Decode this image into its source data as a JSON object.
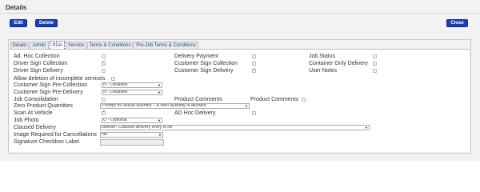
{
  "panel": {
    "title": "Details"
  },
  "toolbar": {
    "edit": "Edit",
    "delete": "Delete",
    "close": "Close"
  },
  "tabs": [
    "Details",
    "Admin",
    "PDA",
    "Service",
    "Terms & Conditions",
    "Pre-Job Terms & Conditions"
  ],
  "active_tab": "PDA",
  "fields": {
    "ad_hoc_collection": {
      "label": "Ad. Hoc Collection",
      "checked": false
    },
    "driver_sign_collection": {
      "label": "Driver Sign Collection",
      "checked": true
    },
    "driver_sign_delivery": {
      "label": "Driver Sign Delivery",
      "checked": false
    },
    "allow_deletion": {
      "label": "Allow deletion of incomplete services",
      "checked": false
    },
    "customer_sign_pre_collection": {
      "label": "Customer Sign Pre-Collection",
      "value": "N - Disabled"
    },
    "customer_sign_pre_delivery": {
      "label": "Customer Sign Pre-Delivery",
      "value": "N - Disabled"
    },
    "job_consolidation": {
      "label": "Job Consolidation",
      "checked": false
    },
    "zero_product_quantities": {
      "label": "Zero Product Quantities",
      "value": "Prompt for actual quantity – A zero quantity is allowed"
    },
    "scan_at_vehicle": {
      "label": "Scan At Vehicle",
      "checked": true
    },
    "job_photo": {
      "label": "Job Photo",
      "value": "O - Optional"
    },
    "claused_delivery": {
      "label": "Claused Delivery",
      "value": "Neither: Claused delivery entry is off"
    },
    "image_required_cancellations": {
      "label": "Image Required for Cancellations",
      "value": "No"
    },
    "signature_checkbox_label": {
      "label": "Signature Checkbox Label",
      "value": ""
    },
    "delivery_payment": {
      "label": "Delivery Payment",
      "checked": false
    },
    "customer_sign_collection": {
      "label": "Customer Sign Collection",
      "checked": false
    },
    "customer_sign_delivery": {
      "label": "Customer Sign Delivery",
      "checked": true
    },
    "product_comments_1": {
      "label": "Product Comments",
      "checked": false
    },
    "product_comments_2": {
      "label": "Product Comments",
      "checked": false
    },
    "ad_hoc_delivery": {
      "label": "AD Hoc Delivery",
      "checked": false
    },
    "job_status": {
      "label": "Job Status",
      "checked": false
    },
    "container_only_delivery": {
      "label": "Container Only Delivery",
      "checked": false
    },
    "user_notes": {
      "label": "User Notes",
      "checked": false
    }
  }
}
